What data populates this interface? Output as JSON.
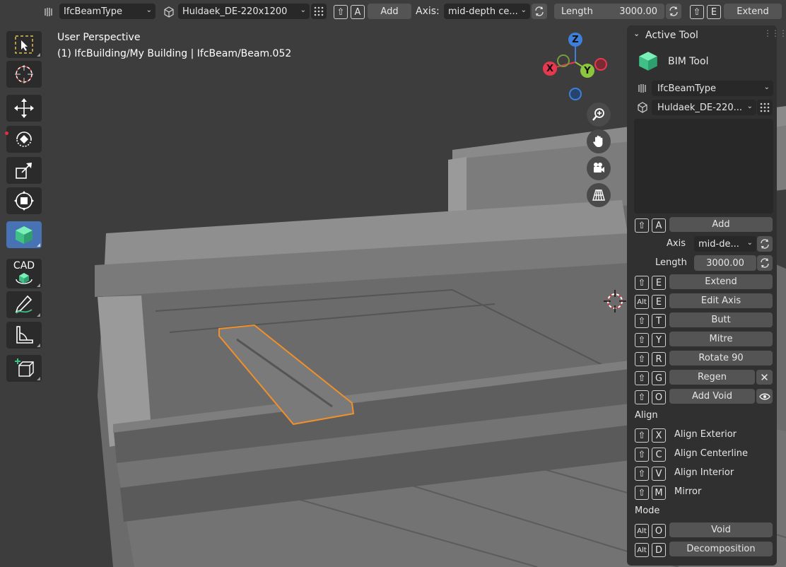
{
  "header": {
    "type_select": "IfcBeamType",
    "profile_select": "Huldaek_DE-220x1200",
    "add_key": "A",
    "add_label": "Add",
    "axis_label": "Axis:",
    "axis_value": "mid-depth ce...",
    "length_label": "Length",
    "length_value": "3000.00",
    "extend_key": "E",
    "extend_label": "Extend"
  },
  "viewport": {
    "view_name": "User Perspective",
    "object_path": "(1) IfcBuilding/My Building | IfcBeam/Beam.052"
  },
  "gizmo": {
    "x_label": "X",
    "y_label": "Y",
    "z_label": "Z",
    "x_color": "#e8384f",
    "y_color": "#8cc63f",
    "z_color": "#3d7fd9"
  },
  "toolbar": {
    "cad_label": "CAD",
    "items": [
      "select-box",
      "cursor",
      "move",
      "rotate",
      "scale",
      "transform",
      "bim-tool",
      "cad-tool",
      "annotate",
      "measure",
      "add-cube"
    ]
  },
  "panel": {
    "title": "Active Tool",
    "tool_name": "BIM Tool",
    "type_select": "IfcBeamType",
    "profile_select": "Huldaek_DE-220...",
    "add_key": "A",
    "add_label": "Add",
    "axis_label": "Axis",
    "axis_value": "mid-de...",
    "length_label": "Length",
    "length_value": "3000.00",
    "rows": [
      {
        "mod": "shift",
        "key": "E",
        "label": "Extend"
      },
      {
        "mod": "Alt",
        "key": "E",
        "label": "Edit Axis"
      },
      {
        "mod": "shift",
        "key": "T",
        "label": "Butt"
      },
      {
        "mod": "shift",
        "key": "Y",
        "label": "Mitre"
      },
      {
        "mod": "shift",
        "key": "R",
        "label": "Rotate 90"
      },
      {
        "mod": "shift",
        "key": "G",
        "label": "Regen"
      },
      {
        "mod": "shift",
        "key": "O",
        "label": "Add Void"
      }
    ],
    "align_heading": "Align",
    "align_rows": [
      {
        "key": "X",
        "label": "Align Exterior"
      },
      {
        "key": "C",
        "label": "Align Centerline"
      },
      {
        "key": "V",
        "label": "Align Interior"
      },
      {
        "key": "M",
        "label": "Mirror"
      }
    ],
    "mode_heading": "Mode",
    "mode_rows": [
      {
        "mod": "Alt",
        "key": "O",
        "label": "Void"
      },
      {
        "mod": "Alt",
        "key": "D",
        "label": "Decomposition"
      }
    ]
  },
  "colors": {
    "selection_outline": "#f0902a",
    "active_tool": "#4772b3",
    "bim_green": "#4dd99a"
  }
}
